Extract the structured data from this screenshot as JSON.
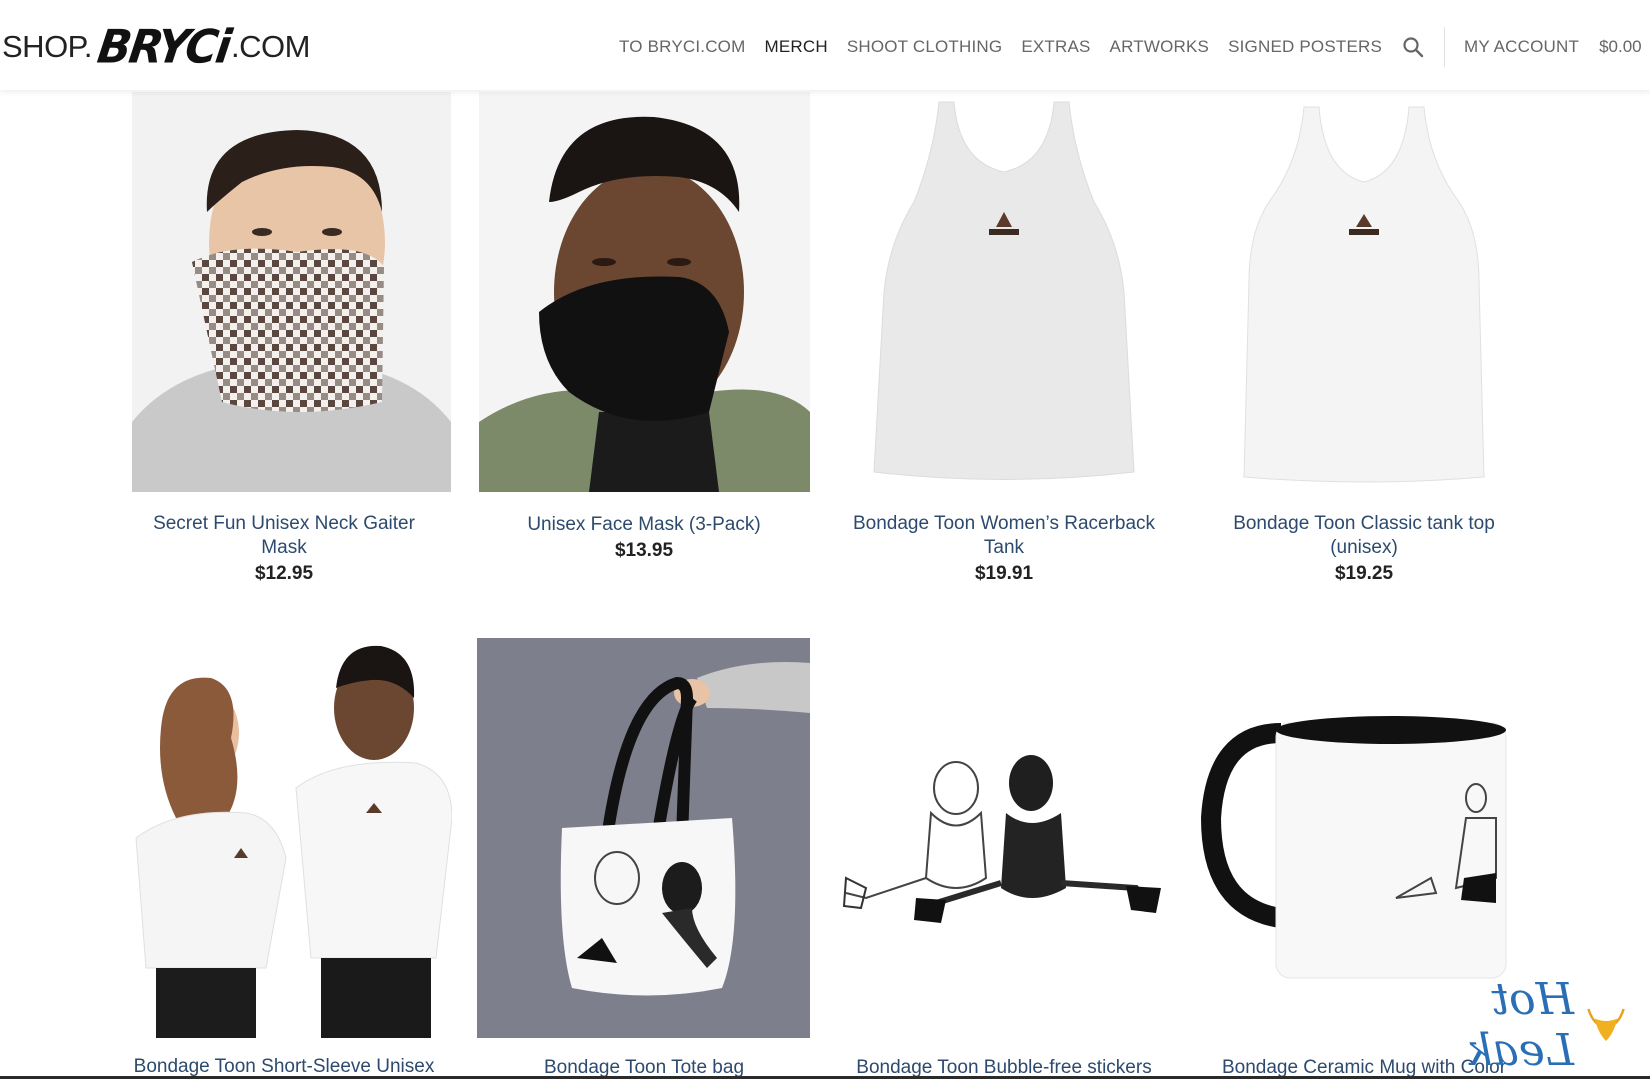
{
  "header": {
    "logo": {
      "prefix": "SHOP.",
      "brand": "BRYCi",
      "suffix": ".COM"
    },
    "nav": [
      {
        "label": "TO BRYCI.COM"
      },
      {
        "label": "MERCH",
        "active": true
      },
      {
        "label": "SHOOT CLOTHING"
      },
      {
        "label": "EXTRAS"
      },
      {
        "label": "ARTWORKS"
      },
      {
        "label": "SIGNED POSTERS"
      }
    ],
    "search_icon": "search-icon",
    "account_label": "MY ACCOUNT",
    "cart_total": "$0.00"
  },
  "products": [
    {
      "title": "Secret Fun Unisex Neck Gaiter Mask",
      "price": "$12.95"
    },
    {
      "title": "Unisex Face Mask (3-Pack)",
      "price": "$13.95"
    },
    {
      "title": "Bondage Toon Women’s Racerback Tank",
      "price": "$19.91"
    },
    {
      "title": "Bondage Toon Classic tank top (unisex)",
      "price": "$19.25"
    },
    {
      "title": "Bondage Toon Short-Sleeve Unisex",
      "price": ""
    },
    {
      "title": "Bondage Toon Tote bag",
      "price": ""
    },
    {
      "title": "Bondage Toon Bubble-free stickers",
      "price": ""
    },
    {
      "title": "Bondage Ceramic Mug with Color",
      "price": ""
    }
  ],
  "watermark": {
    "text": "Hot Leak"
  },
  "colors": {
    "link": "#2d4a6e",
    "price": "#222222",
    "nav": "#666666",
    "nav_active": "#222222"
  }
}
